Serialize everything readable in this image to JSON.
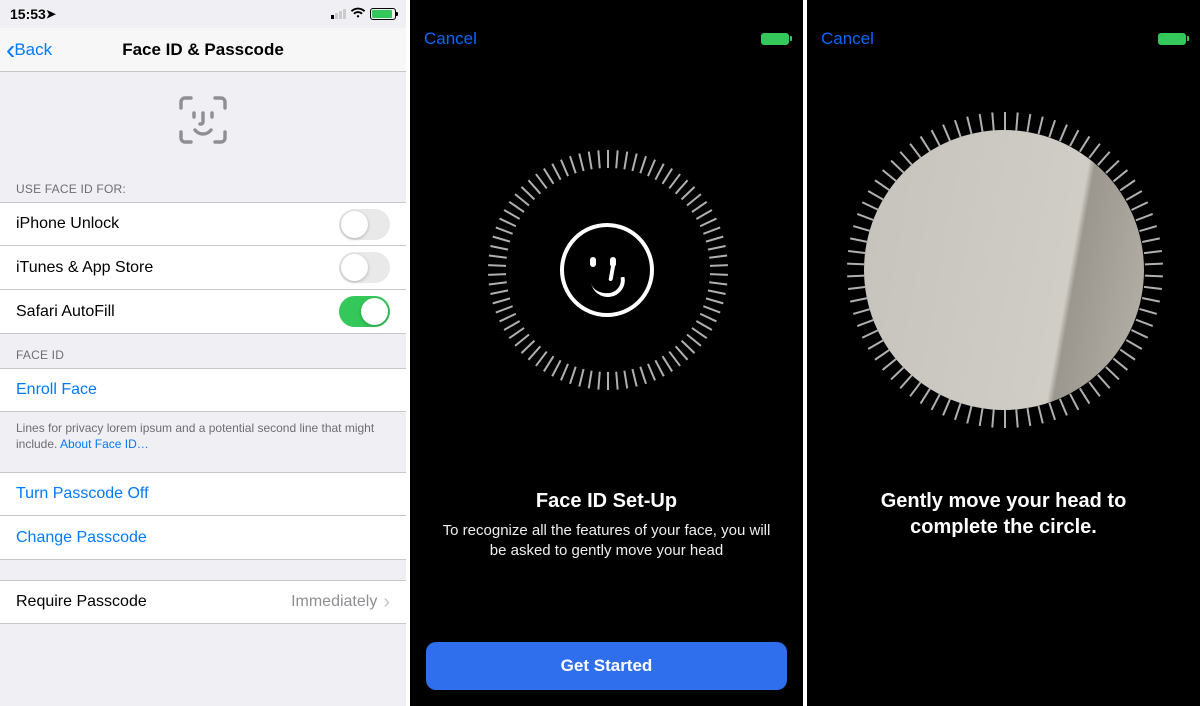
{
  "screen1": {
    "status": {
      "time": "15:53"
    },
    "nav": {
      "back": "Back",
      "title": "Face ID & Passcode"
    },
    "section1_header": "USE FACE ID FOR:",
    "toggles": [
      {
        "label": "iPhone Unlock",
        "on": false
      },
      {
        "label": "iTunes & App Store",
        "on": false
      },
      {
        "label": "Safari AutoFill",
        "on": true
      }
    ],
    "section2_header": "FACE ID",
    "enroll": "Enroll Face",
    "footer_text": "Lines for privacy lorem ipsum and a potential second line that might include. ",
    "footer_link": "About Face ID…",
    "turn_off": "Turn Passcode Off",
    "change": "Change Passcode",
    "require": {
      "label": "Require Passcode",
      "value": "Immediately"
    }
  },
  "screen2": {
    "cancel": "Cancel",
    "title": "Face ID Set-Up",
    "body": "To recognize all the features of your face, you will be asked to gently move your head",
    "button": "Get Started"
  },
  "screen3": {
    "cancel": "Cancel",
    "instruct": "Gently move your head to complete the circle."
  }
}
